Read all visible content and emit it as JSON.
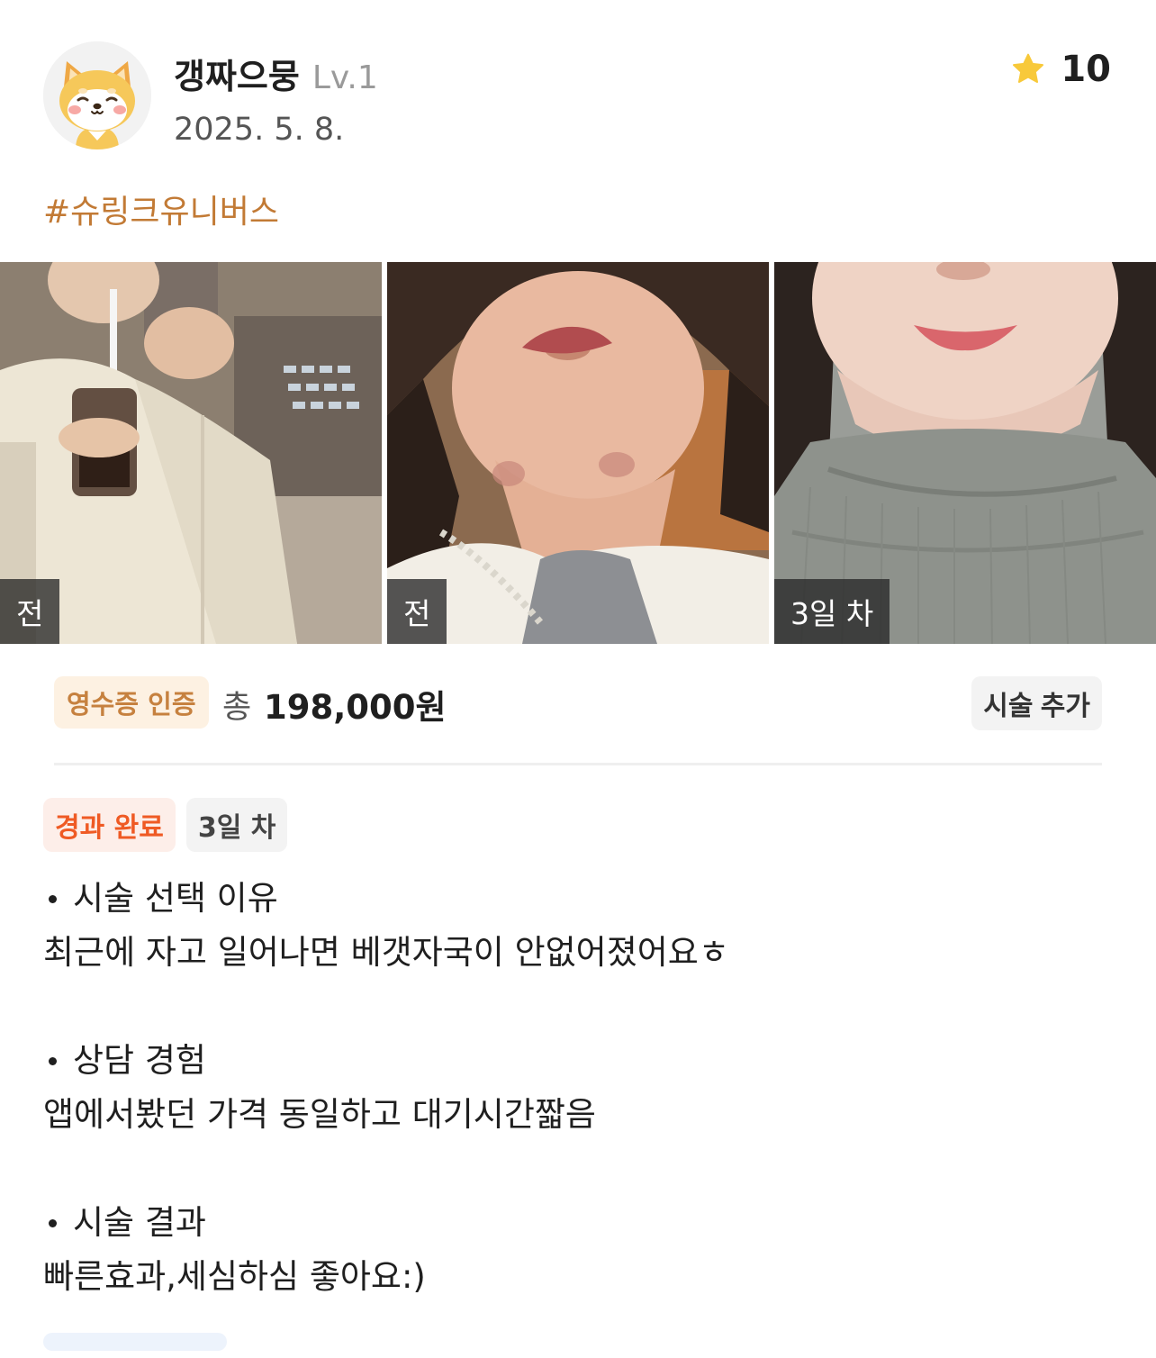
{
  "user": {
    "name": "갱짜으뭉",
    "level": "Lv.1",
    "date": "2025. 5. 8.",
    "avatar_icon": "shiba-dog-avatar-icon"
  },
  "rating": {
    "icon": "star-icon",
    "value": "10",
    "star_color": "#f8c93a"
  },
  "hashtag": "#슈링크유니버스",
  "photos": [
    {
      "label": "전",
      "alt": "before photo 1"
    },
    {
      "label": "전",
      "alt": "before photo 2"
    },
    {
      "label": "3일 차",
      "alt": "after photo day 3"
    }
  ],
  "price": {
    "receipt_badge": "영수증 인증",
    "total_label": "총",
    "total_amount": "198,000원"
  },
  "add_treatment_label": "시술 추가",
  "status_badges": {
    "complete": "경과 완료",
    "day": "3일 차"
  },
  "review": [
    {
      "heading": "시술 선택 이유",
      "body": "최근에 자고 일어나면 베갯자국이 안없어졌어요ㅎ"
    },
    {
      "heading": "상담 경험",
      "body": "앱에서봤던 가격 동일하고 대기시간짧음"
    },
    {
      "heading": "시술 결과",
      "body": "빠른효과,세심하심 좋아요:)"
    }
  ],
  "colors": {
    "accent_orange": "#ef5a24",
    "hashtag_brown": "#c27a35",
    "receipt_badge_text": "#c6813f"
  }
}
